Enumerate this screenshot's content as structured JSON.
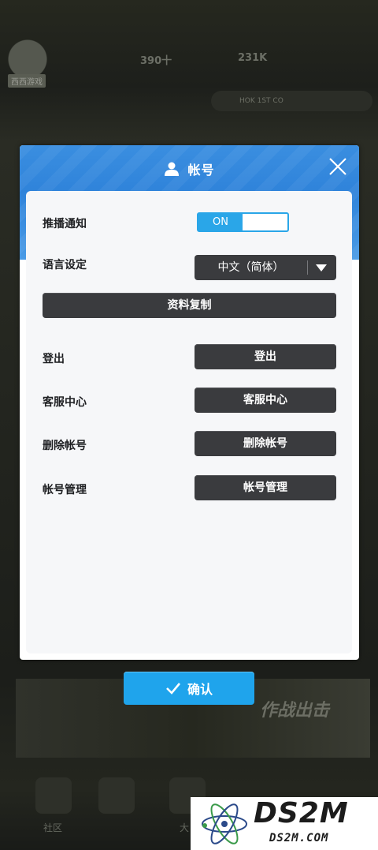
{
  "background": {
    "tag": "西西游戏",
    "topbar_stats": [
      "390十",
      "231K"
    ],
    "ticker_text": "HOK 1ST CO",
    "promo_title": "作战出击",
    "nav_labels": [
      "社区",
      "",
      "大"
    ]
  },
  "modal": {
    "title": "帐号",
    "rows": {
      "push_label": "推播通知",
      "toggle_on_label": "ON",
      "language_label": "语言设定",
      "language_value": "中文（简体）",
      "copy_button": "资料复制",
      "logout_label": "登出",
      "logout_button": "登出",
      "support_label": "客服中心",
      "support_button": "客服中心",
      "delete_label": "删除帐号",
      "delete_button": "删除帐号",
      "manage_label": "帐号管理",
      "manage_button": "帐号管理"
    }
  },
  "confirm_label": "确认",
  "watermark": {
    "main": "DS2M",
    "sub": "DS2M.COM"
  },
  "colors": {
    "accent": "#1fa4ec",
    "header_blue": "#2f83da",
    "dark_button": "#3a3b3e",
    "highlight": "#e5141b"
  }
}
